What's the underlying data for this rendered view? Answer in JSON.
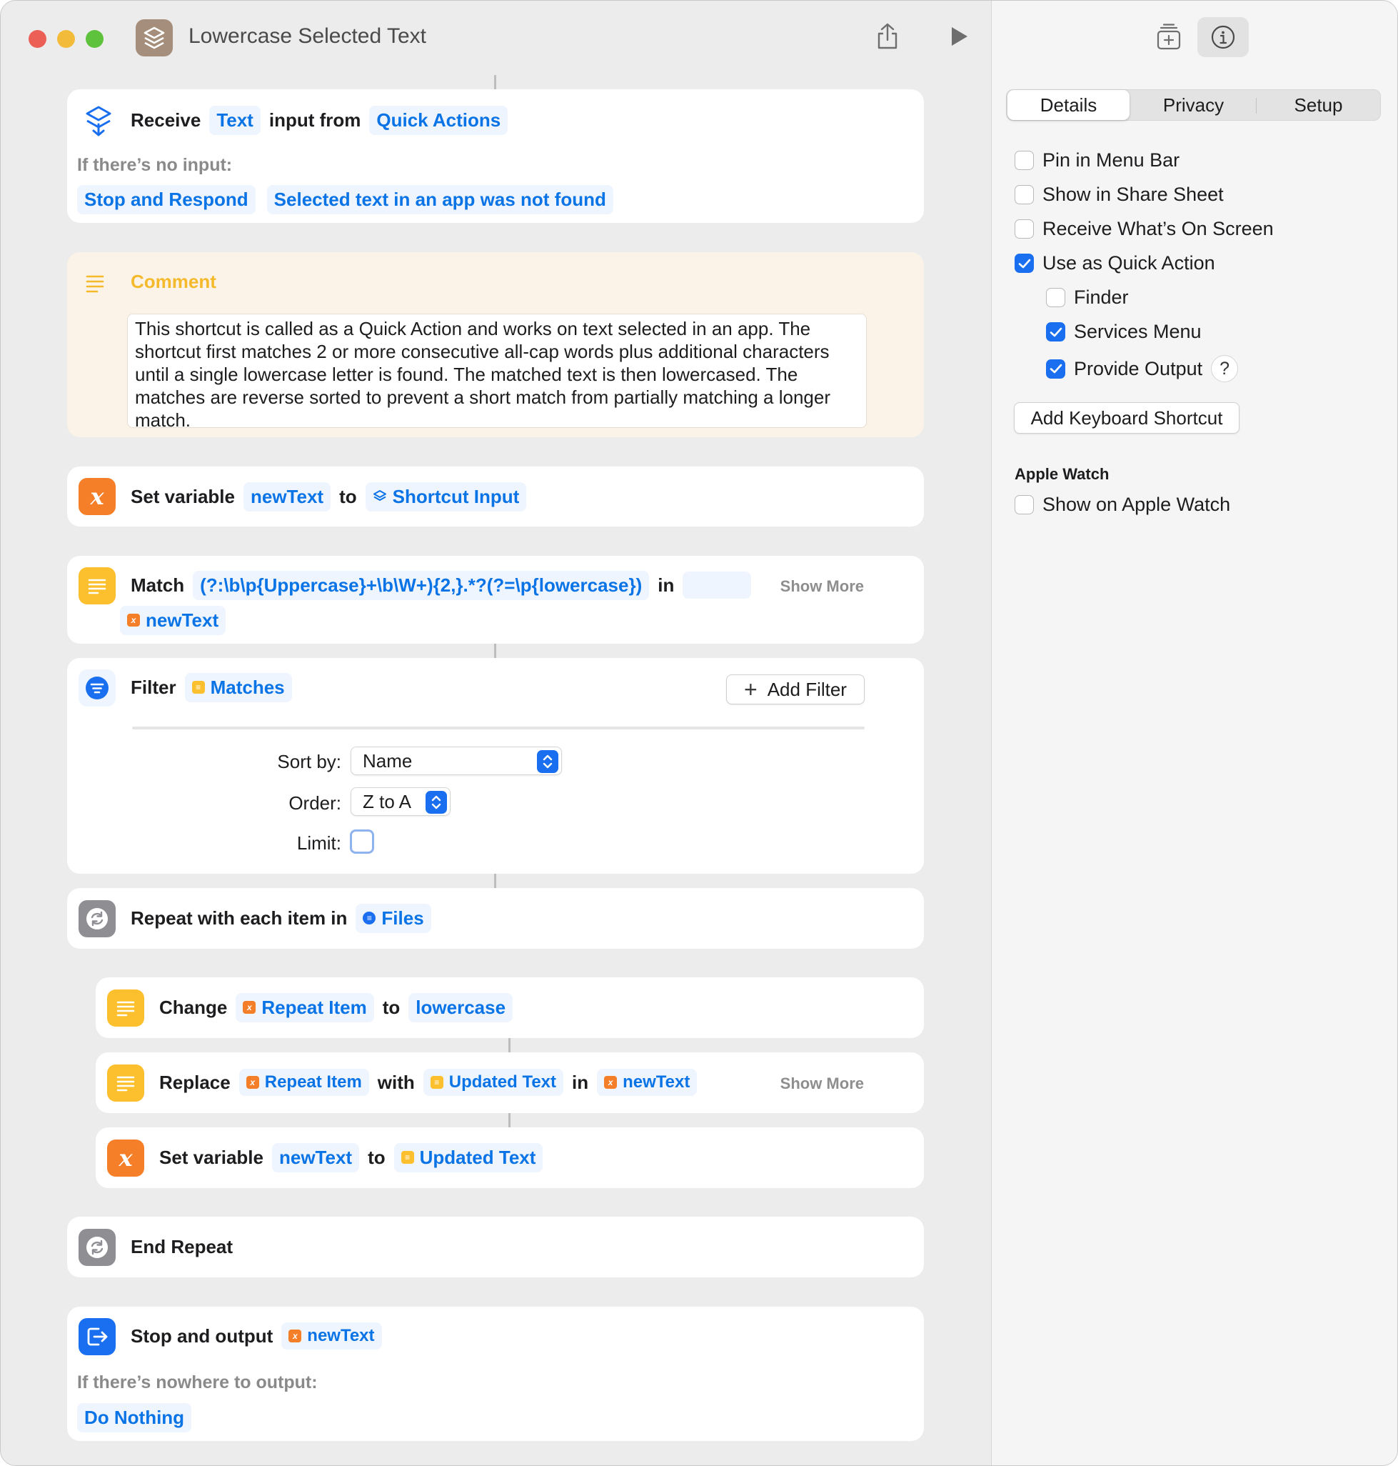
{
  "window": {
    "title": "Lowercase Selected Text"
  },
  "actions": {
    "receive": {
      "verb": "Receive",
      "type": "Text",
      "mid": "input from",
      "source": "Quick Actions",
      "sub": "If there’s no input:",
      "opt1": "Stop and Respond",
      "opt2": "Selected text in an app was not found"
    },
    "comment": {
      "label": "Comment",
      "text": "This shortcut is called as a Quick Action and works on text selected in an app. The shortcut first matches 2 or more consecutive all-cap words plus additional characters until a single lowercase letter is found. The matched text is then lowercased. The matches are reverse sorted to prevent a short match from partially matching a longer match."
    },
    "set1": {
      "verb": "Set variable",
      "var": "newText",
      "to": "to",
      "value": "Shortcut Input"
    },
    "match": {
      "verb": "Match",
      "pattern": "(?:\\b\\p{Uppercase}+\\b\\W+){2,}.*?(?=\\p{lowercase})",
      "in": "in",
      "var": "newText",
      "show_more": "Show More"
    },
    "filter": {
      "verb": "Filter",
      "var": "Matches",
      "add_filter": "Add Filter",
      "sort_label": "Sort by:",
      "sort_value": "Name",
      "order_label": "Order:",
      "order_value": "Z to A",
      "limit_label": "Limit:"
    },
    "repeat": {
      "verb": "Repeat with each item in",
      "var": "Files"
    },
    "change": {
      "verb": "Change",
      "var": "Repeat Item",
      "to": "to",
      "value": "lowercase"
    },
    "replace": {
      "verb": "Replace",
      "var": "Repeat Item",
      "with": "with",
      "value": "Updated Text",
      "in": "in",
      "target": "newText",
      "show_more": "Show More"
    },
    "set2": {
      "verb": "Set variable",
      "var": "newText",
      "to": "to",
      "value": "Updated Text"
    },
    "end_repeat": {
      "label": "End Repeat"
    },
    "stop": {
      "verb": "Stop and output",
      "var": "newText",
      "sub": "If there’s nowhere to output:",
      "opt": "Do Nothing"
    }
  },
  "sidebar": {
    "tabs": [
      "Details",
      "Privacy",
      "Setup"
    ],
    "options": {
      "pin": {
        "label": "Pin in Menu Bar",
        "checked": false
      },
      "share": {
        "label": "Show in Share Sheet",
        "checked": false
      },
      "screen": {
        "label": "Receive What’s On Screen",
        "checked": false
      },
      "quick": {
        "label": "Use as Quick Action",
        "checked": true
      },
      "finder": {
        "label": "Finder",
        "checked": false
      },
      "services": {
        "label": "Services Menu",
        "checked": true
      },
      "output": {
        "label": "Provide Output",
        "checked": true
      }
    },
    "help": "?",
    "keyboard_button": "Add Keyboard Shortcut",
    "watch_heading": "Apple Watch",
    "watch_option": {
      "label": "Show on Apple Watch",
      "checked": false
    }
  },
  "colors": {
    "accent": "#1a6ff0",
    "token_text": "#0a74e6",
    "token_bg": "#eef5fe",
    "orange": "#f57f28",
    "yellow": "#fcc02e",
    "gray": "#8e8e93",
    "comment_bg": "#fbf3e7",
    "comment_label": "#f5b92c"
  }
}
